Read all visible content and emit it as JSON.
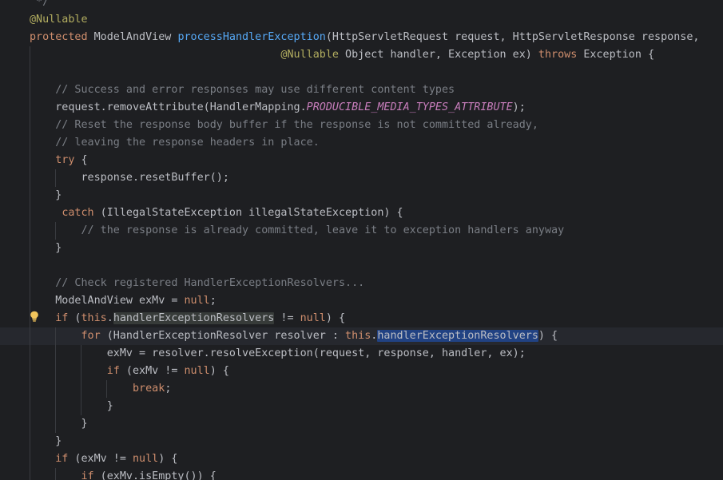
{
  "colors": {
    "background": "#1e1f22",
    "keyword": "#cf8e6d",
    "annotation": "#b3ae60",
    "method": "#56a8f5",
    "comment": "#7a7e85",
    "constant": "#c77dbb",
    "text": "#bcbec4",
    "selection": "#214283",
    "usage_highlight": "#373b39"
  },
  "icons": [
    "lightbulb-icon"
  ],
  "lines": [
    [
      {
        "t": " */",
        "c": "cmt"
      }
    ],
    [
      {
        "t": "@Nullable",
        "c": "ann"
      }
    ],
    [
      {
        "t": "protected",
        "c": "kw"
      },
      {
        "t": " ModelAndView "
      },
      {
        "t": "processHandlerException",
        "c": "fn"
      },
      {
        "t": "(HttpServletRequest request, HttpServletResponse response,"
      }
    ],
    [
      {
        "t": "                                       "
      },
      {
        "t": "@Nullable",
        "c": "ann"
      },
      {
        "t": " Object handler, Exception ex) "
      },
      {
        "t": "throws",
        "c": "kw"
      },
      {
        "t": " Exception {"
      }
    ],
    [],
    [
      {
        "t": "    "
      },
      {
        "t": "// Success and error responses may use different content types",
        "c": "cmt"
      }
    ],
    [
      {
        "t": "    request.removeAttribute(HandlerMapping."
      },
      {
        "t": "PRODUCIBLE_MEDIA_TYPES_ATTRIBUTE",
        "c": "const"
      },
      {
        "t": ");"
      }
    ],
    [
      {
        "t": "    "
      },
      {
        "t": "// Reset the response body buffer if the response is not committed already,",
        "c": "cmt"
      }
    ],
    [
      {
        "t": "    "
      },
      {
        "t": "// leaving the response headers in place.",
        "c": "cmt"
      }
    ],
    [
      {
        "t": "    "
      },
      {
        "t": "try",
        "c": "kw"
      },
      {
        "t": " {"
      }
    ],
    [
      {
        "t": "        response.resetBuffer();"
      }
    ],
    [
      {
        "t": "    }"
      }
    ],
    [
      {
        "t": "     "
      },
      {
        "t": "catch",
        "c": "kw"
      },
      {
        "t": " (IllegalStateException illegalStateException) {"
      }
    ],
    [
      {
        "t": "        "
      },
      {
        "t": "// the response is already committed, leave it to exception handlers anyway",
        "c": "cmt"
      }
    ],
    [
      {
        "t": "    }"
      }
    ],
    [],
    [
      {
        "t": "    "
      },
      {
        "t": "// Check registered HandlerExceptionResolvers...",
        "c": "cmt"
      }
    ],
    [
      {
        "t": "    ModelAndView exMv = "
      },
      {
        "t": "null",
        "c": "kw"
      },
      {
        "t": ";"
      }
    ],
    [
      {
        "t": "    "
      },
      {
        "t": "if",
        "c": "kw"
      },
      {
        "t": " ("
      },
      {
        "t": "this",
        "c": "kw"
      },
      {
        "t": "."
      },
      {
        "t": "handlerExceptionResolvers",
        "c": "fld hl-read"
      },
      {
        "t": " != "
      },
      {
        "t": "null",
        "c": "kw"
      },
      {
        "t": ") {"
      }
    ],
    [
      {
        "t": "        "
      },
      {
        "t": "for",
        "c": "kw"
      },
      {
        "t": " (HandlerExceptionResolver resolver : "
      },
      {
        "t": "this",
        "c": "kw"
      },
      {
        "t": "."
      },
      {
        "t": "handlerExceptionResolvers",
        "c": "fld hl-sel"
      },
      {
        "t": ") {"
      }
    ],
    [
      {
        "t": "            exMv = resolver.resolveException(request, response, handler, ex);"
      }
    ],
    [
      {
        "t": "            "
      },
      {
        "t": "if",
        "c": "kw"
      },
      {
        "t": " (exMv != "
      },
      {
        "t": "null",
        "c": "kw"
      },
      {
        "t": ") {"
      }
    ],
    [
      {
        "t": "                "
      },
      {
        "t": "break",
        "c": "kw"
      },
      {
        "t": ";"
      }
    ],
    [
      {
        "t": "            }"
      }
    ],
    [
      {
        "t": "        }"
      }
    ],
    [
      {
        "t": "    }"
      }
    ],
    [
      {
        "t": "    "
      },
      {
        "t": "if",
        "c": "kw"
      },
      {
        "t": " (exMv != "
      },
      {
        "t": "null",
        "c": "kw"
      },
      {
        "t": ") {"
      }
    ],
    [
      {
        "t": "        "
      },
      {
        "t": "if",
        "c": "kw"
      },
      {
        "t": " (exMv.isEmpty()) {"
      }
    ]
  ]
}
